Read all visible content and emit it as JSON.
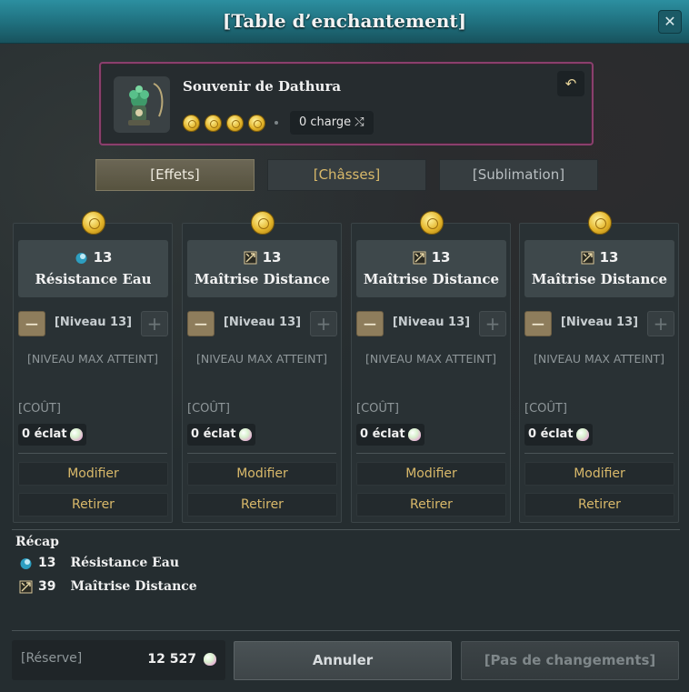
{
  "window": {
    "title": "[Table d’enchantement]",
    "close_symbol": "✕"
  },
  "item": {
    "name": "Souvenir de Dathura",
    "charge_text": "0 charge",
    "charge_icon": "⤭",
    "undo_symbol": "↶",
    "coin_count": 4
  },
  "tabs": [
    {
      "label": "[Effets]",
      "active": true
    },
    {
      "label": "[Châsses]",
      "active": false
    },
    {
      "label": "[Sublimation]",
      "active": false
    }
  ],
  "cards": [
    {
      "icon": "water-resistance-icon",
      "value": "13",
      "stat": "Résistance Eau",
      "level": "[Niveau 13]",
      "max_note": "[NIVEAU MAX ATTEINT]",
      "cost_label": "[COÛT]",
      "cost": "0 éclat",
      "modify": "Modifier",
      "remove": "Retirer"
    },
    {
      "icon": "distance-mastery-icon",
      "value": "13",
      "stat": "Maîtrise Distance",
      "level": "[Niveau 13]",
      "max_note": "[NIVEAU MAX ATTEINT]",
      "cost_label": "[COÛT]",
      "cost": "0 éclat",
      "modify": "Modifier",
      "remove": "Retirer"
    },
    {
      "icon": "distance-mastery-icon",
      "value": "13",
      "stat": "Maîtrise Distance",
      "level": "[Niveau 13]",
      "max_note": "[NIVEAU MAX ATTEINT]",
      "cost_label": "[COÛT]",
      "cost": "0 éclat",
      "modify": "Modifier",
      "remove": "Retirer"
    },
    {
      "icon": "distance-mastery-icon",
      "value": "13",
      "stat": "Maîtrise Distance",
      "level": "[Niveau 13]",
      "max_note": "[NIVEAU MAX ATTEINT]",
      "cost_label": "[COÛT]",
      "cost": "0 éclat",
      "modify": "Modifier",
      "remove": "Retirer"
    }
  ],
  "stepper": {
    "minus": "−",
    "plus": "+"
  },
  "recap": {
    "title": "Récap",
    "rows": [
      {
        "icon": "water-resistance-icon",
        "value": "13",
        "stat": "Résistance Eau"
      },
      {
        "icon": "distance-mastery-icon",
        "value": "39",
        "stat": "Maîtrise Distance"
      }
    ]
  },
  "footer": {
    "reserve_label": "[Réserve]",
    "reserve_value": "12 527",
    "cancel_label": "Annuler",
    "no_changes_label": "[Pas de changements]"
  },
  "colors": {
    "accent_gold": "#d9b96a",
    "title_teal": "#1f6f7d",
    "item_border": "#8a3f6d"
  }
}
